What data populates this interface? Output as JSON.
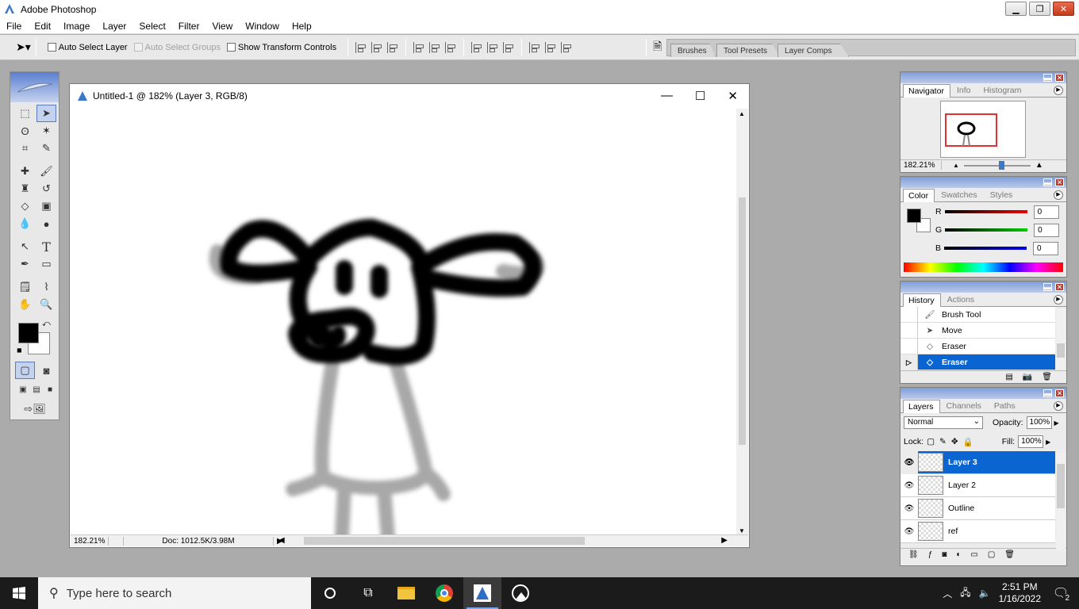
{
  "app": {
    "title": "Adobe Photoshop"
  },
  "window_buttons": {
    "minimize": "▁",
    "restore": "❐",
    "close": "✕"
  },
  "menu": [
    "File",
    "Edit",
    "Image",
    "Layer",
    "Select",
    "Filter",
    "View",
    "Window",
    "Help"
  ],
  "options": {
    "auto_select_layer": "Auto Select Layer",
    "auto_select_groups": "Auto Select Groups",
    "show_transform": "Show Transform Controls"
  },
  "well_tabs": [
    "Brushes",
    "Tool Presets",
    "Layer Comps"
  ],
  "document": {
    "title": "Untitled-1 @ 182% (Layer 3, RGB/8)",
    "zoom": "182.21%",
    "doc_size": "Doc: 1012.5K/3.98M"
  },
  "navigator": {
    "tabs": [
      "Navigator",
      "Info",
      "Histogram"
    ],
    "zoom": "182.21%"
  },
  "color": {
    "tabs": [
      "Color",
      "Swatches",
      "Styles"
    ],
    "r_label": "R",
    "g_label": "G",
    "b_label": "B",
    "r": "0",
    "g": "0",
    "b": "0",
    "foreground": "#000000",
    "background": "#ffffff"
  },
  "history": {
    "tabs": [
      "History",
      "Actions"
    ],
    "items": [
      "Brush Tool",
      "Move",
      "Eraser",
      "Eraser"
    ],
    "selected_index": 3
  },
  "layers": {
    "tabs": [
      "Layers",
      "Channels",
      "Paths"
    ],
    "blend_mode": "Normal",
    "opacity_label": "Opacity:",
    "opacity": "100%",
    "lock_label": "Lock:",
    "fill_label": "Fill:",
    "fill": "100%",
    "items": [
      "Layer 3",
      "Layer 2",
      "Outline",
      "ref"
    ],
    "selected_index": 0
  },
  "taskbar": {
    "search_placeholder": "Type here to search",
    "time": "2:51 PM",
    "date": "1/16/2022",
    "notifications": "2"
  }
}
